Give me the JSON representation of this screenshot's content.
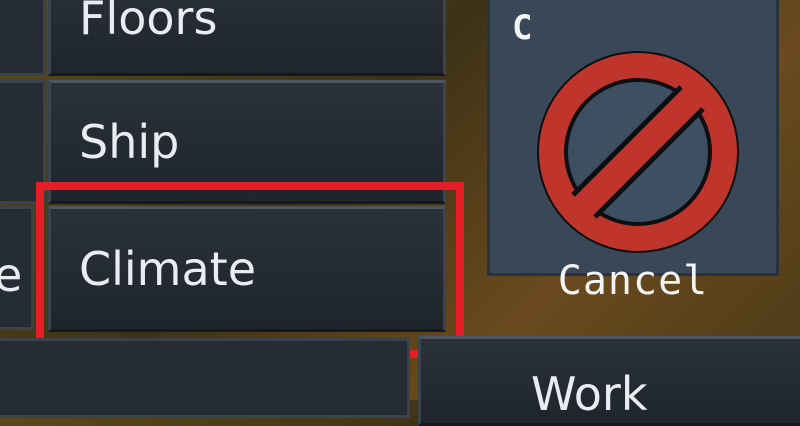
{
  "menu": {
    "items": [
      {
        "label": "Floors"
      },
      {
        "label": "Ship"
      },
      {
        "label": "Climate"
      },
      {
        "label": "Work"
      }
    ],
    "selected": "Climate",
    "partial_left_char": "e"
  },
  "cancel": {
    "hotkey": "C",
    "label": "Cancel",
    "icon": "cancel-prohibited-icon"
  },
  "colors": {
    "highlight": "#e51d27",
    "button_bg": "#222930",
    "cancel_red": "#c0352b",
    "card_bg": "#3a4756"
  }
}
